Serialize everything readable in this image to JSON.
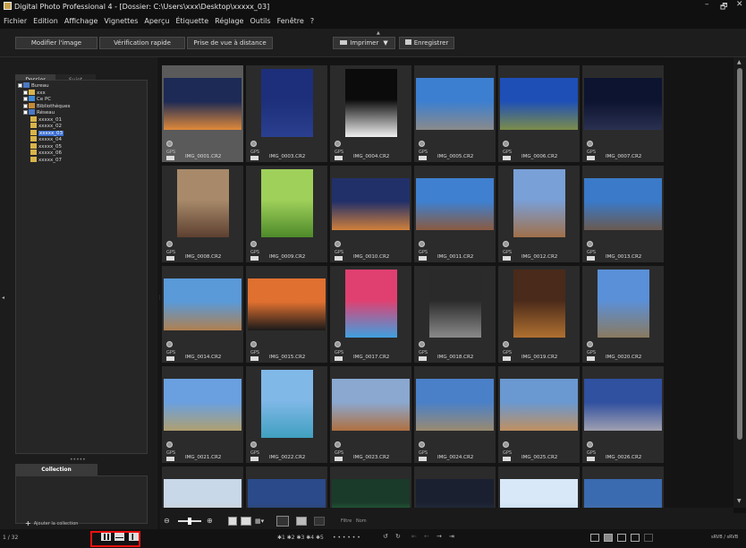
{
  "window": {
    "title": "Digital Photo Professional 4 - [Dossier: C:\\Users\\xxx\\Desktop\\xxxxx_03]",
    "min": "–",
    "max": "🗗",
    "close": "✕"
  },
  "menu": [
    "Fichier",
    "Edition",
    "Affichage",
    "Vignettes",
    "Aperçu",
    "Étiquette",
    "Réglage",
    "Outils",
    "Fenêtre",
    "?"
  ],
  "toolbar": {
    "edit": "Modifier l'image",
    "check": "Vérification rapide",
    "remote": "Prise de vue à distance",
    "print": "Imprimer",
    "save": "Enregistrer"
  },
  "sidebar": {
    "tab_folder": "Dossier",
    "tab_subject": "Sujet",
    "tree": [
      {
        "label": "Bureau",
        "level": 0,
        "type": "desktop"
      },
      {
        "label": "xxx",
        "level": 1,
        "type": "folder"
      },
      {
        "label": "Ce PC",
        "level": 1,
        "type": "pc"
      },
      {
        "label": "Bibliothèques",
        "level": 1,
        "type": "lib"
      },
      {
        "label": "Réseau",
        "level": 1,
        "type": "net"
      },
      {
        "label": "xxxxx_01",
        "level": 2,
        "type": "folder"
      },
      {
        "label": "xxxxx_02",
        "level": 2,
        "type": "folder"
      },
      {
        "label": "xxxxx_03",
        "level": 2,
        "type": "folder",
        "selected": true
      },
      {
        "label": "xxxxx_04",
        "level": 2,
        "type": "folder"
      },
      {
        "label": "xxxxx_05",
        "level": 2,
        "type": "folder"
      },
      {
        "label": "xxxxx_06",
        "level": 2,
        "type": "folder"
      },
      {
        "label": "xxxxx_07",
        "level": 2,
        "type": "folder"
      }
    ],
    "grip": "•••••",
    "collection_tab": "Collection",
    "add_collection": "Ajouter la collection"
  },
  "thumbs": [
    {
      "name": "IMG_0001.CR2",
      "gps": "GPS",
      "orient": "landscape",
      "c1": "#1c2a55",
      "c2": "#e08a3a",
      "selected": true
    },
    {
      "name": "IMG_0003.CR2",
      "gps": "GPS",
      "orient": "portrait",
      "c1": "#1d2f7a",
      "c2": "#2a3f8f"
    },
    {
      "name": "IMG_0004.CR2",
      "gps": "GPS",
      "orient": "portrait",
      "c1": "#0b0b0b",
      "c2": "#f0f0f0"
    },
    {
      "name": "IMG_0005.CR2",
      "gps": "GPS",
      "orient": "landscape",
      "c1": "#3c7fd1",
      "c2": "#8a8a8a"
    },
    {
      "name": "IMG_0006.CR2",
      "gps": "GPS",
      "orient": "landscape",
      "c1": "#1e4fb7",
      "c2": "#7c8d4a"
    },
    {
      "name": "IMG_0007.CR2",
      "gps": "GPS",
      "orient": "landscape",
      "c1": "#0d1430",
      "c2": "#2a3050"
    },
    {
      "name": "IMG_0008.CR2",
      "gps": "GPS",
      "orient": "portrait",
      "c1": "#a88a6a",
      "c2": "#5d4030"
    },
    {
      "name": "IMG_0009.CR2",
      "gps": "GPS",
      "orient": "portrait",
      "c1": "#9fd05a",
      "c2": "#4e8a2a"
    },
    {
      "name": "IMG_0010.CR2",
      "gps": "GPS",
      "orient": "landscape",
      "c1": "#22306a",
      "c2": "#d0803a"
    },
    {
      "name": "IMG_0011.CR2",
      "gps": "GPS",
      "orient": "landscape",
      "c1": "#3f80d0",
      "c2": "#8a5a40"
    },
    {
      "name": "IMG_0012.CR2",
      "gps": "GPS",
      "orient": "portrait",
      "c1": "#7aa0d8",
      "c2": "#a0704a"
    },
    {
      "name": "IMG_0013.CR2",
      "gps": "GPS",
      "orient": "landscape",
      "c1": "#3a7ac8",
      "c2": "#6a5a50"
    },
    {
      "name": "IMG_0014.CR2",
      "gps": "GPS",
      "orient": "landscape",
      "c1": "#5a9ad8",
      "c2": "#b08050"
    },
    {
      "name": "IMG_0015.CR2",
      "gps": "GPS",
      "orient": "landscape",
      "c1": "#e07030",
      "c2": "#1a1a1a"
    },
    {
      "name": "IMG_0017.CR2",
      "gps": "GPS",
      "orient": "portrait",
      "c1": "#e04070",
      "c2": "#40a0e0"
    },
    {
      "name": "IMG_0018.CR2",
      "gps": "GPS",
      "orient": "portrait",
      "c1": "#2a2a2a",
      "c2": "#8a8a8a"
    },
    {
      "name": "IMG_0019.CR2",
      "gps": "GPS",
      "orient": "portrait",
      "c1": "#4a2a1a",
      "c2": "#b07030"
    },
    {
      "name": "IMG_0020.CR2",
      "gps": "GPS",
      "orient": "portrait",
      "c1": "#5a90d8",
      "c2": "#8a7a60"
    },
    {
      "name": "IMG_0021.CR2",
      "gps": "GPS",
      "orient": "landscape",
      "c1": "#6aa0e0",
      "c2": "#b0a070"
    },
    {
      "name": "IMG_0022.CR2",
      "gps": "GPS",
      "orient": "portrait",
      "c1": "#80b8e8",
      "c2": "#40a0c0"
    },
    {
      "name": "IMG_0023.CR2",
      "gps": "GPS",
      "orient": "landscape",
      "c1": "#8aa8d0",
      "c2": "#b07040"
    },
    {
      "name": "IMG_0024.CR2",
      "gps": "GPS",
      "orient": "landscape",
      "c1": "#4a80c8",
      "c2": "#9a8a70"
    },
    {
      "name": "IMG_0025.CR2",
      "gps": "GPS",
      "orient": "landscape",
      "c1": "#6a98d0",
      "c2": "#c09060"
    },
    {
      "name": "IMG_0026.CR2",
      "gps": "GPS",
      "orient": "landscape",
      "c1": "#3050a0",
      "c2": "#a0a0b0"
    },
    {
      "name": "",
      "orient": "landscape",
      "c1": "#c8d8e8",
      "c2": "#d0c0a0"
    },
    {
      "name": "",
      "orient": "landscape",
      "c1": "#2a4a8a",
      "c2": "#3a3a3a"
    },
    {
      "name": "",
      "orient": "landscape",
      "c1": "#1a3a2a",
      "c2": "#40c060"
    },
    {
      "name": "",
      "orient": "landscape",
      "c1": "#1a2030",
      "c2": "#3a4a5a"
    },
    {
      "name": "",
      "orient": "landscape",
      "c1": "#d8e8f8",
      "c2": "#a0c0e0"
    },
    {
      "name": "",
      "orient": "landscape",
      "c1": "#3a6ab0",
      "c2": "#5a7aa0"
    }
  ],
  "viewbar": {
    "filter": "Filtre",
    "name": "Nom"
  },
  "status": {
    "count": "1 / 32",
    "ratings": "✱1 ✱2 ✱3 ✱4 ✱5",
    "dots": "• • • • • •",
    "colorspace": "sRVB / sRVB"
  }
}
